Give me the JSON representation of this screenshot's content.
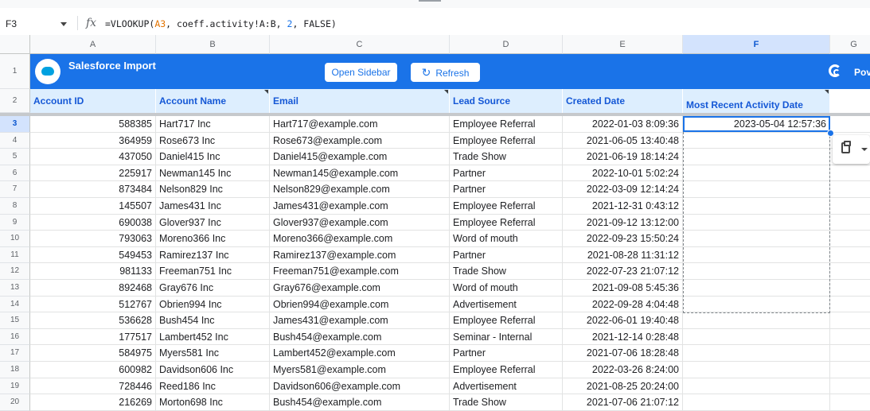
{
  "cell_ref": "F3",
  "formula": {
    "prefix": "=VLOOKUP(",
    "ref": "A3",
    "mid": ", coeff.activity!A:B, ",
    "num": "2",
    "suffix": ", FALSE)"
  },
  "columns": [
    "A",
    "B",
    "C",
    "D",
    "E",
    "F",
    "G"
  ],
  "row_numbers": [
    "1",
    "2",
    "3",
    "4",
    "5",
    "6",
    "7",
    "8",
    "9",
    "10",
    "11",
    "12",
    "13",
    "14",
    "15",
    "16",
    "17",
    "18",
    "19",
    "20"
  ],
  "banner": {
    "title": "Salesforce Import",
    "open_sidebar": "Open Sidebar",
    "refresh": "Refresh",
    "powered": "Pov",
    "color": "#1a73e8"
  },
  "headers": [
    "Account ID",
    "Account Name",
    "Email",
    "Lead Source",
    "Created Date",
    "Most Recent Activity Date"
  ],
  "rows": [
    {
      "id": "588385",
      "name": "Hart717 Inc",
      "email": "Hart717@example.com",
      "source": "Employee Referral",
      "created": "2022-01-03 8:09:36",
      "activity": "2023-05-04 12:57:36"
    },
    {
      "id": "364959",
      "name": "Rose673 Inc",
      "email": "Rose673@example.com",
      "source": "Employee Referral",
      "created": "2021-06-05 13:40:48",
      "activity": ""
    },
    {
      "id": "437050",
      "name": "Daniel415 Inc",
      "email": "Daniel415@example.com",
      "source": "Trade Show",
      "created": "2021-06-19 18:14:24",
      "activity": ""
    },
    {
      "id": "225917",
      "name": "Newman145 Inc",
      "email": "Newman145@example.com",
      "source": "Partner",
      "created": "2022-10-01 5:02:24",
      "activity": ""
    },
    {
      "id": "873484",
      "name": "Nelson829 Inc",
      "email": "Nelson829@example.com",
      "source": "Partner",
      "created": "2022-03-09 12:14:24",
      "activity": ""
    },
    {
      "id": "145507",
      "name": "James431 Inc",
      "email": "James431@example.com",
      "source": "Employee Referral",
      "created": "2021-12-31 0:43:12",
      "activity": ""
    },
    {
      "id": "690038",
      "name": "Glover937 Inc",
      "email": "Glover937@example.com",
      "source": "Employee Referral",
      "created": "2021-09-12 13:12:00",
      "activity": ""
    },
    {
      "id": "793063",
      "name": "Moreno366 Inc",
      "email": "Moreno366@example.com",
      "source": "Word of mouth",
      "created": "2022-09-23 15:50:24",
      "activity": ""
    },
    {
      "id": "549453",
      "name": "Ramirez137 Inc",
      "email": "Ramirez137@example.com",
      "source": "Partner",
      "created": "2021-08-28 11:31:12",
      "activity": ""
    },
    {
      "id": "981133",
      "name": "Freeman751 Inc",
      "email": "Freeman751@example.com",
      "source": "Trade Show",
      "created": "2022-07-23 21:07:12",
      "activity": ""
    },
    {
      "id": "892468",
      "name": "Gray676 Inc",
      "email": "Gray676@example.com",
      "source": "Word of mouth",
      "created": "2021-09-08 5:45:36",
      "activity": ""
    },
    {
      "id": "512767",
      "name": "Obrien994 Inc",
      "email": "Obrien994@example.com",
      "source": "Advertisement",
      "created": "2022-09-28 4:04:48",
      "activity": ""
    },
    {
      "id": "536628",
      "name": "Bush454 Inc",
      "email": "James431@example.com",
      "source": "Employee Referral",
      "created": "2022-06-01 19:40:48",
      "activity": ""
    },
    {
      "id": "177517",
      "name": "Lambert452 Inc",
      "email": "Bush454@example.com",
      "source": "Seminar - Internal",
      "created": "2021-12-14 0:28:48",
      "activity": ""
    },
    {
      "id": "584975",
      "name": "Myers581 Inc",
      "email": "Lambert452@example.com",
      "source": "Partner",
      "created": "2021-07-06 18:28:48",
      "activity": ""
    },
    {
      "id": "600982",
      "name": "Davidson606 Inc",
      "email": "Myers581@example.com",
      "source": "Employee Referral",
      "created": "2022-03-26 8:24:00",
      "activity": ""
    },
    {
      "id": "728446",
      "name": "Reed186 Inc",
      "email": "Davidson606@example.com",
      "source": "Advertisement",
      "created": "2021-08-25 20:24:00",
      "activity": ""
    },
    {
      "id": "216269",
      "name": "Morton698 Inc",
      "email": "Bush454@example.com",
      "source": "Trade Show",
      "created": "2021-07-06 21:07:12",
      "activity": ""
    }
  ]
}
